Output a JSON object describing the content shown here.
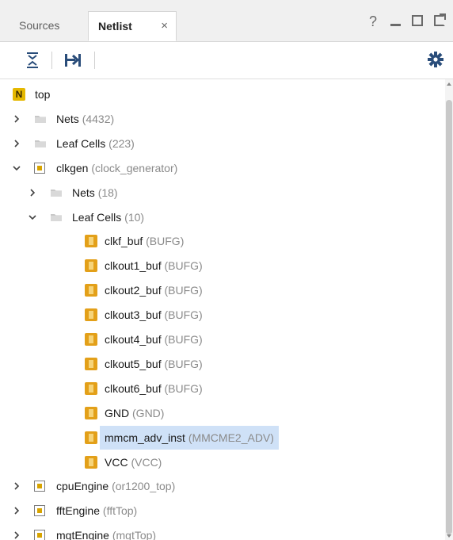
{
  "tabs": {
    "sources": "Sources",
    "netlist": "Netlist",
    "close": "×"
  },
  "window_buttons": {
    "help": "?"
  },
  "toolbar": {
    "collapse_all_icon": "collapse-all-icon",
    "expand_selected_icon": "expand-selected-icon",
    "settings_icon": "gear-icon"
  },
  "colors": {
    "selection": "#cfe1f7",
    "leaf_icon": "#e3a019",
    "top_icon": "#e5b800"
  },
  "tree": [
    {
      "name": "top",
      "sub": "",
      "icon": "top-module-icon",
      "chevron": "",
      "level": 0,
      "top_badge": "N"
    },
    {
      "name": "Nets",
      "sub": "(4432)",
      "icon": "folder-icon",
      "chevron": "right",
      "level": 0
    },
    {
      "name": "Leaf Cells",
      "sub": "(223)",
      "icon": "folder-icon",
      "chevron": "right",
      "level": 0
    },
    {
      "name": "clkgen",
      "sub": "(clock_generator)",
      "icon": "hier-cell-icon",
      "chevron": "down",
      "level": 0
    },
    {
      "name": "Nets",
      "sub": "(18)",
      "icon": "folder-icon",
      "chevron": "right",
      "level": 1
    },
    {
      "name": "Leaf Cells",
      "sub": "(10)",
      "icon": "folder-icon",
      "chevron": "down",
      "level": 1
    },
    {
      "name": "clkf_buf",
      "sub": "(BUFG)",
      "icon": "leaf-cell-icon",
      "chevron": "",
      "level": 2
    },
    {
      "name": "clkout1_buf",
      "sub": "(BUFG)",
      "icon": "leaf-cell-icon",
      "chevron": "",
      "level": 2
    },
    {
      "name": "clkout2_buf",
      "sub": "(BUFG)",
      "icon": "leaf-cell-icon",
      "chevron": "",
      "level": 2
    },
    {
      "name": "clkout3_buf",
      "sub": "(BUFG)",
      "icon": "leaf-cell-icon",
      "chevron": "",
      "level": 2
    },
    {
      "name": "clkout4_buf",
      "sub": "(BUFG)",
      "icon": "leaf-cell-icon",
      "chevron": "",
      "level": 2
    },
    {
      "name": "clkout5_buf",
      "sub": "(BUFG)",
      "icon": "leaf-cell-icon",
      "chevron": "",
      "level": 2
    },
    {
      "name": "clkout6_buf",
      "sub": "(BUFG)",
      "icon": "leaf-cell-icon",
      "chevron": "",
      "level": 2
    },
    {
      "name": "GND",
      "sub": "(GND)",
      "icon": "leaf-cell-icon",
      "chevron": "",
      "level": 2
    },
    {
      "name": "mmcm_adv_inst",
      "sub": "(MMCME2_ADV)",
      "icon": "leaf-cell-icon",
      "chevron": "",
      "level": 2,
      "selected": true
    },
    {
      "name": "VCC",
      "sub": "(VCC)",
      "icon": "leaf-cell-icon",
      "chevron": "",
      "level": 2
    },
    {
      "name": "cpuEngine",
      "sub": "(or1200_top)",
      "icon": "hier-cell-icon",
      "chevron": "right",
      "level": 0
    },
    {
      "name": "fftEngine",
      "sub": "(fftTop)",
      "icon": "hier-cell-icon",
      "chevron": "right",
      "level": 0
    },
    {
      "name": "mgtEngine",
      "sub": "(mgtTop)",
      "icon": "hier-cell-icon",
      "chevron": "right",
      "level": 0
    }
  ]
}
